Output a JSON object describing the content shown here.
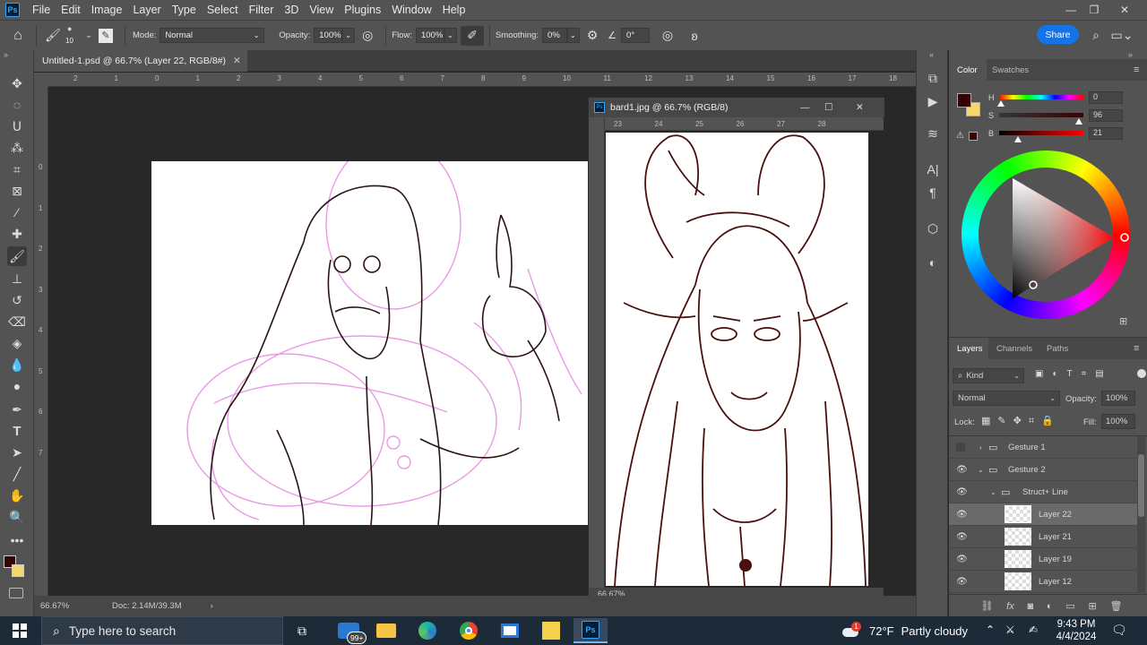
{
  "app": {
    "logo": "Ps"
  },
  "menu": {
    "items": [
      "File",
      "Edit",
      "Image",
      "Layer",
      "Type",
      "Select",
      "Filter",
      "3D",
      "View",
      "Plugins",
      "Window",
      "Help"
    ]
  },
  "options": {
    "brush_size": "10",
    "mode_label": "Mode:",
    "mode_value": "Normal",
    "opacity_label": "Opacity:",
    "opacity_value": "100%",
    "flow_label": "Flow:",
    "flow_value": "100%",
    "smoothing_label": "Smoothing:",
    "smoothing_value": "0%",
    "angle_value": "0°",
    "share_label": "Share"
  },
  "document": {
    "tab_title": "Untitled-1.psd @ 66.7% (Layer 22, RGB/8#)",
    "zoom": "66.67%",
    "doc_info": "Doc: 2.14M/39.3M",
    "ruler_top": [
      "2",
      "1",
      "0",
      "1",
      "2",
      "3",
      "4",
      "5",
      "6",
      "7",
      "8",
      "9",
      "10",
      "11",
      "12",
      "13",
      "14",
      "15",
      "16",
      "17",
      "18"
    ],
    "ruler_left": [
      "0",
      "1",
      "2",
      "3",
      "4",
      "5",
      "6",
      "7"
    ]
  },
  "float_window": {
    "title": "bard1.jpg @ 66.7% (RGB/8)",
    "zoom": "66.67%",
    "ruler": [
      "23",
      "24",
      "25",
      "26",
      "27",
      "28"
    ]
  },
  "color_panel": {
    "tabs": [
      "Color",
      "Swatches"
    ],
    "h_label": "H",
    "h_value": "0",
    "s_label": "S",
    "s_value": "96",
    "b_label": "B",
    "b_value": "21",
    "fg_color": "#360303",
    "bg_color": "#f5d76e"
  },
  "layers_panel": {
    "tabs": [
      "Layers",
      "Channels",
      "Paths"
    ],
    "filter_label": "Kind",
    "blend_mode": "Normal",
    "opacity_label": "Opacity:",
    "opacity_value": "100%",
    "lock_label": "Lock:",
    "fill_label": "Fill:",
    "fill_value": "100%",
    "rows": [
      {
        "name": "Gesture 1",
        "type": "group"
      },
      {
        "name": "Gesture 2",
        "type": "group-open"
      },
      {
        "name": "Struct+ Line",
        "type": "group-open"
      },
      {
        "name": "Layer 22",
        "type": "layer"
      },
      {
        "name": "Layer 21",
        "type": "layer"
      },
      {
        "name": "Layer 19",
        "type": "layer"
      },
      {
        "name": "Layer 12",
        "type": "layer"
      }
    ]
  },
  "taskbar": {
    "search_placeholder": "Type here to search",
    "mail_badge": "99+",
    "weather_temp": "72°F",
    "weather_desc": "Partly cloudy",
    "weather_badge": "1",
    "time": "9:43 PM",
    "date": "4/4/2024"
  }
}
